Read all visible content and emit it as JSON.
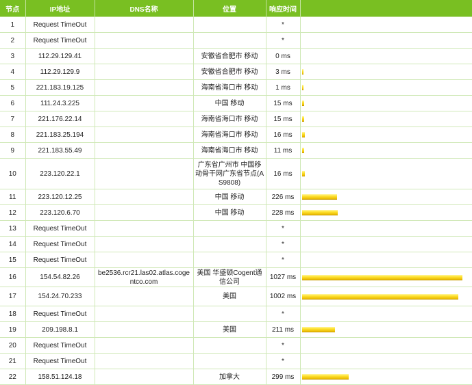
{
  "table": {
    "headers": {
      "hop": "节点",
      "ip": "IP地址",
      "dns": "DNS名称",
      "location": "位置",
      "time": "响应时间",
      "bar": ""
    },
    "rows": [
      {
        "hop": "1",
        "ip": "Request TimeOut",
        "dns": "",
        "location": "",
        "time": "*",
        "ms": 0
      },
      {
        "hop": "2",
        "ip": "Request TimeOut",
        "dns": "",
        "location": "",
        "time": "*",
        "ms": 0
      },
      {
        "hop": "3",
        "ip": "112.29.129.41",
        "dns": "",
        "location": "安徽省合肥市 移动",
        "time": "0 ms",
        "ms": 0
      },
      {
        "hop": "4",
        "ip": "112.29.129.9",
        "dns": "",
        "location": "安徽省合肥市 移动",
        "time": "3 ms",
        "ms": 3
      },
      {
        "hop": "5",
        "ip": "221.183.19.125",
        "dns": "",
        "location": "海南省海口市 移动",
        "time": "1 ms",
        "ms": 1
      },
      {
        "hop": "6",
        "ip": "111.24.3.225",
        "dns": "",
        "location": "中国 移动",
        "time": "15 ms",
        "ms": 15
      },
      {
        "hop": "7",
        "ip": "221.176.22.14",
        "dns": "",
        "location": "海南省海口市 移动",
        "time": "15 ms",
        "ms": 15
      },
      {
        "hop": "8",
        "ip": "221.183.25.194",
        "dns": "",
        "location": "海南省海口市 移动",
        "time": "16 ms",
        "ms": 16
      },
      {
        "hop": "9",
        "ip": "221.183.55.49",
        "dns": "",
        "location": "海南省海口市 移动",
        "time": "11 ms",
        "ms": 11
      },
      {
        "hop": "10",
        "ip": "223.120.22.1",
        "dns": "",
        "location": "广东省广州市 中国移动骨干网广东省节点(AS9808)",
        "time": "16 ms",
        "ms": 16
      },
      {
        "hop": "11",
        "ip": "223.120.12.25",
        "dns": "",
        "location": "中国 移动",
        "time": "226 ms",
        "ms": 226
      },
      {
        "hop": "12",
        "ip": "223.120.6.70",
        "dns": "",
        "location": "中国 移动",
        "time": "228 ms",
        "ms": 228
      },
      {
        "hop": "13",
        "ip": "Request TimeOut",
        "dns": "",
        "location": "",
        "time": "*",
        "ms": 0
      },
      {
        "hop": "14",
        "ip": "Request TimeOut",
        "dns": "",
        "location": "",
        "time": "*",
        "ms": 0
      },
      {
        "hop": "15",
        "ip": "Request TimeOut",
        "dns": "",
        "location": "",
        "time": "*",
        "ms": 0
      },
      {
        "hop": "16",
        "ip": "154.54.82.26",
        "dns": "be2536.rcr21.las02.atlas.cogentco.com",
        "location": "美国 华盛顿Cogent通信公司",
        "time": "1027 ms",
        "ms": 1027
      },
      {
        "hop": "17",
        "ip": "154.24.70.233",
        "dns": "",
        "location": "美国",
        "time": "1002 ms",
        "ms": 1002
      },
      {
        "hop": "18",
        "ip": "Request TimeOut",
        "dns": "",
        "location": "",
        "time": "*",
        "ms": 0
      },
      {
        "hop": "19",
        "ip": "209.198.8.1",
        "dns": "",
        "location": "美国",
        "time": "211 ms",
        "ms": 211
      },
      {
        "hop": "20",
        "ip": "Request TimeOut",
        "dns": "",
        "location": "",
        "time": "*",
        "ms": 0
      },
      {
        "hop": "21",
        "ip": "Request TimeOut",
        "dns": "",
        "location": "",
        "time": "*",
        "ms": 0
      },
      {
        "hop": "22",
        "ip": "158.51.124.18",
        "dns": "",
        "location": "加拿大",
        "time": "299 ms",
        "ms": 299
      }
    ]
  },
  "colors": {
    "header_bg": "#79bf22",
    "header_text": "#ffffff",
    "grid_line": "#cfe8b6",
    "bar_fill": "#ffe230"
  }
}
